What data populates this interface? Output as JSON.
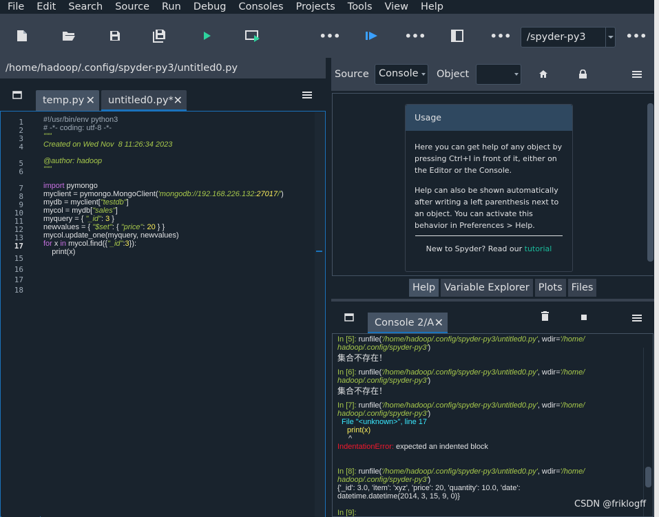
{
  "menu": [
    "File",
    "Edit",
    "Search",
    "Source",
    "Run",
    "Debug",
    "Consoles",
    "Projects",
    "Tools",
    "View",
    "Help"
  ],
  "toolbar": {
    "icons": [
      "new-file-icon",
      "open-folder-icon",
      "save-icon",
      "save-all-icon",
      "run-icon",
      "run-cell-icon",
      "more-icon",
      "debug-icon",
      "more-icon",
      "maximize-pane-icon",
      "more-icon",
      "more-icon"
    ],
    "working_dir": "/spyder-py3"
  },
  "editor": {
    "path": "/home/hadoop/.config/spyder-py3/untitled0.py",
    "tabs": [
      {
        "label": "temp.py",
        "close": "✕"
      },
      {
        "label": "untitled0.py*",
        "close": "✕"
      }
    ],
    "line_numbers": [
      "1",
      "2",
      "3",
      "4",
      "5",
      "6",
      "7",
      "8",
      "9",
      "10",
      "11",
      "12",
      "13",
      "17",
      "15",
      "16",
      "17",
      "18"
    ],
    "lines": [
      "#!/usr/bin/env python3",
      "# -*- coding: utf-8 -*-",
      "\"\"\"",
      "Created on Wed Nov  8 11:26:34 2023",
      "",
      "@author: hadoop",
      "\"\"\"",
      "",
      "import pymongo",
      "myclient = pymongo.MongoClient('mongodb://192.168.226.132:27017/')",
      "mydb = myclient[\"testdb\"]",
      "mycol = mydb[\"sales\"]",
      "myquery = { \"_id\": 3 }",
      "newvalues = { \"$set\": { \"price\": 20 } }",
      "mycol.update_one(myquery, newvalues)",
      "for x in mycol.find({\"_id\":3}):",
      "    print(x)"
    ]
  },
  "help": {
    "source_label": "Source",
    "source_value": "Console",
    "object_label": "Object",
    "usage_title": "Usage",
    "usage_p1": "Here you can get help of any object by pressing Ctrl+I in front of it, either on the Editor or the Console.",
    "usage_p2": "Help can also be shown automatically after writing a left parenthesis next to an object. You can activate this behavior in Preferences > Help.",
    "usage_new": "New to Spyder? Read our",
    "usage_link": "tutorial",
    "tabs": [
      "Help",
      "Variable Explorer",
      "Plots",
      "Files"
    ]
  },
  "console": {
    "tab": "Console 2/A",
    "close": "✕",
    "runfile_path": "'/home/hadoop/.config/spyder-py3/untitled0.py'",
    "wdir_a": "'/home/",
    "wdir_b": "hadoop/.config/spyder-py3'",
    "msg_not_exist": "集合不存在！",
    "in5": "In [5]:",
    "in6": "In [6]:",
    "in7": "In [7]:",
    "in8": "In [8]:",
    "in9": "In [9]:",
    "file_line": "File \"<unknown>\", line 17",
    "print_line": "print(x)",
    "caret": "^",
    "error_name": "IndentationError:",
    "error_msg": "expected an indented block",
    "result_1": "{'_id': 3.0, 'item': 'xyz', 'price': 20, 'quantity': 10.0, 'date':",
    "result_2": "datetime.datetime(2014, 3, 15, 9, 0)}"
  },
  "watermark": "CSDN @friklogff",
  "colors": {
    "accent": "#1a72bb",
    "bg": "#19232d",
    "panel": "#37414f",
    "string": "#a7c84b",
    "keyword": "#c670e0",
    "number": "#faed5c",
    "error": "#f2182d"
  }
}
